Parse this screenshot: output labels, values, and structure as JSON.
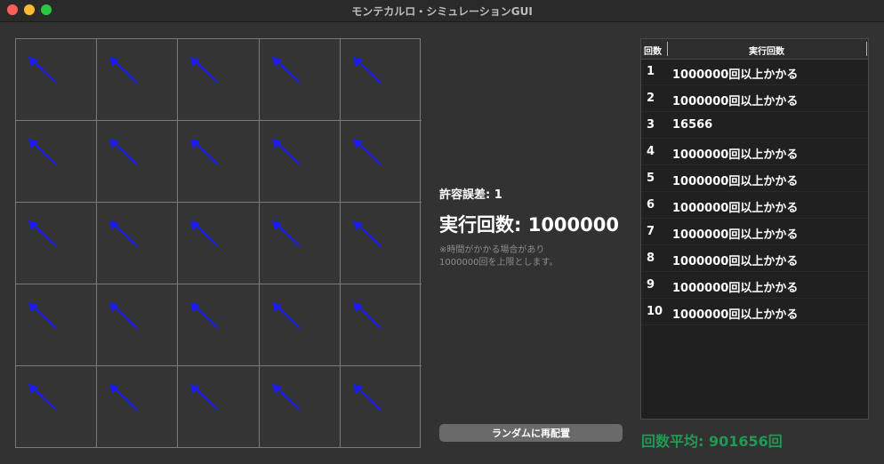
{
  "window": {
    "title": "モンテカルロ・シミュレーションGUI"
  },
  "grid": {
    "rows": 5,
    "cols": 5,
    "arrow_color": "#1a1aff",
    "cell_icon": "arrow-up-left-icon"
  },
  "info": {
    "tolerance": "許容誤差: 1",
    "runs": "実行回数: 1000000",
    "note_line1": "※時間がかかる場合があり",
    "note_line2": "1000000回を上限とします。"
  },
  "button": {
    "label": "ランダムに再配置"
  },
  "table": {
    "headers": [
      "回数",
      "実行回数"
    ],
    "rows": [
      {
        "n": "1",
        "v": "1000000回以上かかる"
      },
      {
        "n": "2",
        "v": "1000000回以上かかる"
      },
      {
        "n": "3",
        "v": "16566"
      },
      {
        "n": "4",
        "v": "1000000回以上かかる"
      },
      {
        "n": "5",
        "v": "1000000回以上かかる"
      },
      {
        "n": "6",
        "v": "1000000回以上かかる"
      },
      {
        "n": "7",
        "v": "1000000回以上かかる"
      },
      {
        "n": "8",
        "v": "1000000回以上かかる"
      },
      {
        "n": "9",
        "v": "1000000回以上かかる"
      },
      {
        "n": "10",
        "v": "1000000回以上かかる"
      }
    ]
  },
  "average": {
    "text": "回数平均: 901656回",
    "color": "#1f9a55"
  }
}
